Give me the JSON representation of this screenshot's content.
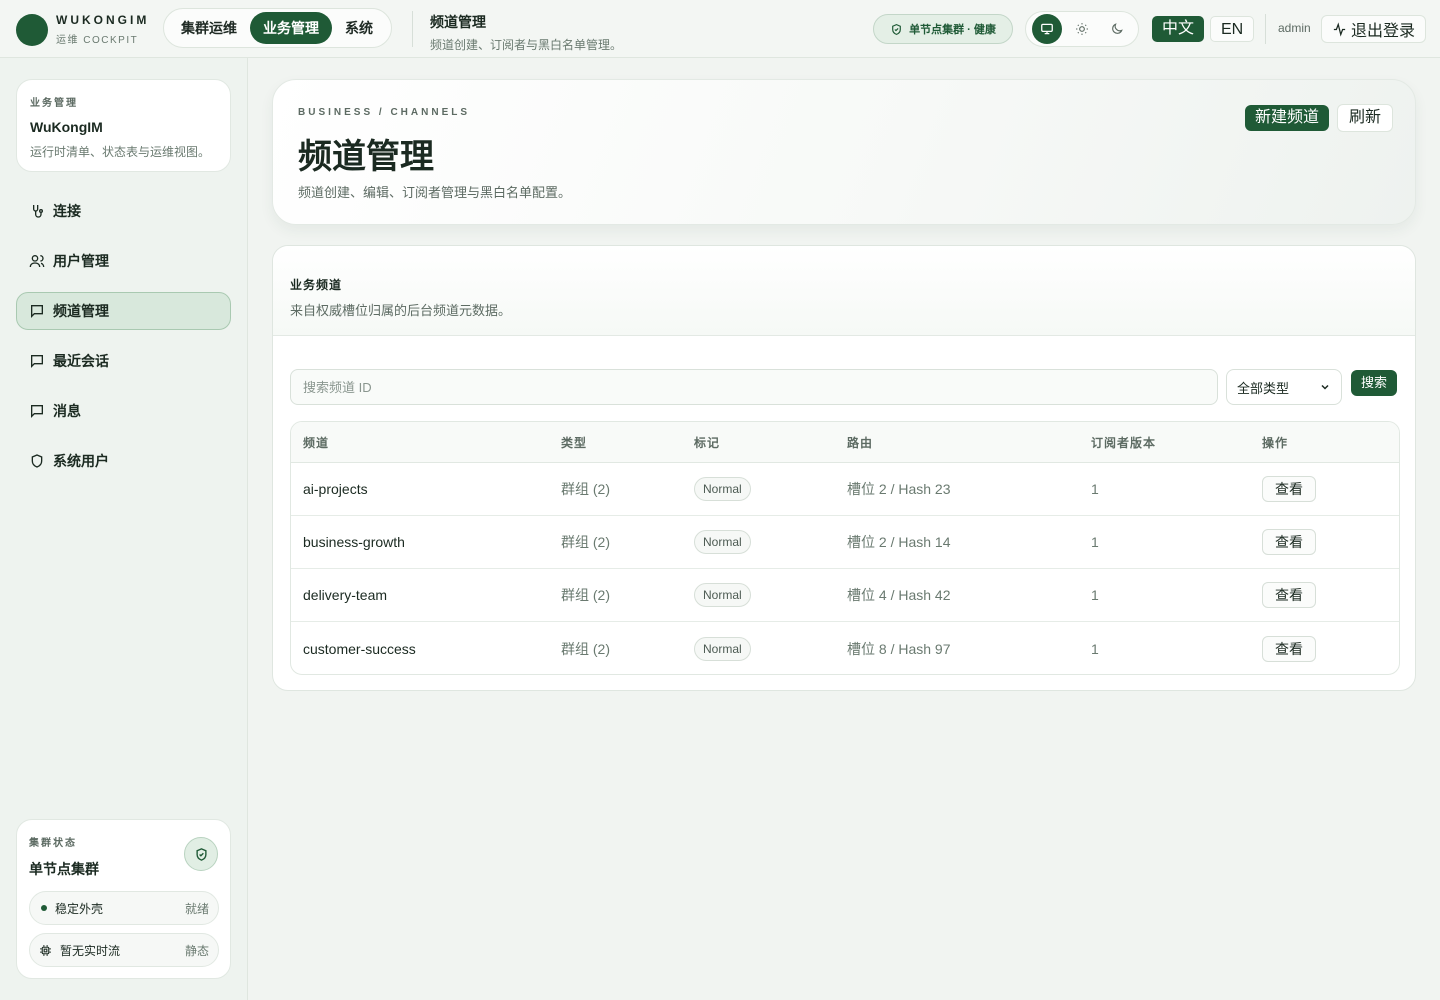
{
  "brand": {
    "name": "WUKONGIM",
    "sub": "运维 COCKPIT"
  },
  "topnav": [
    {
      "label": "集群运维"
    },
    {
      "label": "业务管理"
    },
    {
      "label": "系统"
    }
  ],
  "header": {
    "title": "频道管理",
    "subtitle": "频道创建、订阅者与黑白名单管理。"
  },
  "health_badge": "单节点集群 · 健康",
  "lang": {
    "zh": "中文",
    "en": "EN"
  },
  "user": "admin",
  "logout_label": "退出登录",
  "sidebar": {
    "workspace": {
      "kicker": "业务管理",
      "name": "WuKongIM",
      "desc": "运行时清单、状态表与运维视图。"
    },
    "items": [
      {
        "label": "连接",
        "icon": "connection-icon"
      },
      {
        "label": "用户管理",
        "icon": "users-icon"
      },
      {
        "label": "频道管理",
        "icon": "chat-icon"
      },
      {
        "label": "最近会话",
        "icon": "chat-icon"
      },
      {
        "label": "消息",
        "icon": "chat-icon"
      },
      {
        "label": "系统用户",
        "icon": "shield-icon"
      }
    ],
    "cluster": {
      "kicker": "集群状态",
      "name": "单节点集群",
      "rows": [
        {
          "label": "稳定外壳",
          "value": "就绪"
        },
        {
          "label": "暂无实时流",
          "value": "静态"
        }
      ]
    }
  },
  "hero": {
    "kicker": "BUSINESS / CHANNELS",
    "title": "频道管理",
    "desc": "频道创建、编辑、订阅者管理与黑白名单配置。",
    "new_button": "新建频道",
    "refresh_button": "刷新"
  },
  "panel": {
    "title": "业务频道",
    "desc": "来自权威槽位归属的后台频道元数据。",
    "search_placeholder": "搜索频道 ID",
    "type_filter": "全部类型",
    "search_button": "搜索",
    "columns": [
      "频道",
      "类型",
      "标记",
      "路由",
      "订阅者版本",
      "操作"
    ],
    "rows": [
      {
        "channel": "ai-projects",
        "type": "群组 (2)",
        "tag": "Normal",
        "route": "槽位 2 / Hash 23",
        "version": "1",
        "action": "查看"
      },
      {
        "channel": "business-growth",
        "type": "群组 (2)",
        "tag": "Normal",
        "route": "槽位 2 / Hash 14",
        "version": "1",
        "action": "查看"
      },
      {
        "channel": "delivery-team",
        "type": "群组 (2)",
        "tag": "Normal",
        "route": "槽位 4 / Hash 42",
        "version": "1",
        "action": "查看"
      },
      {
        "channel": "customer-success",
        "type": "群组 (2)",
        "tag": "Normal",
        "route": "槽位 8 / Hash 97",
        "version": "1",
        "action": "查看"
      }
    ]
  },
  "colors": {
    "accent": "#1f5a36",
    "background": "#f1f4f1",
    "active_nav": "#d8e8dc"
  }
}
